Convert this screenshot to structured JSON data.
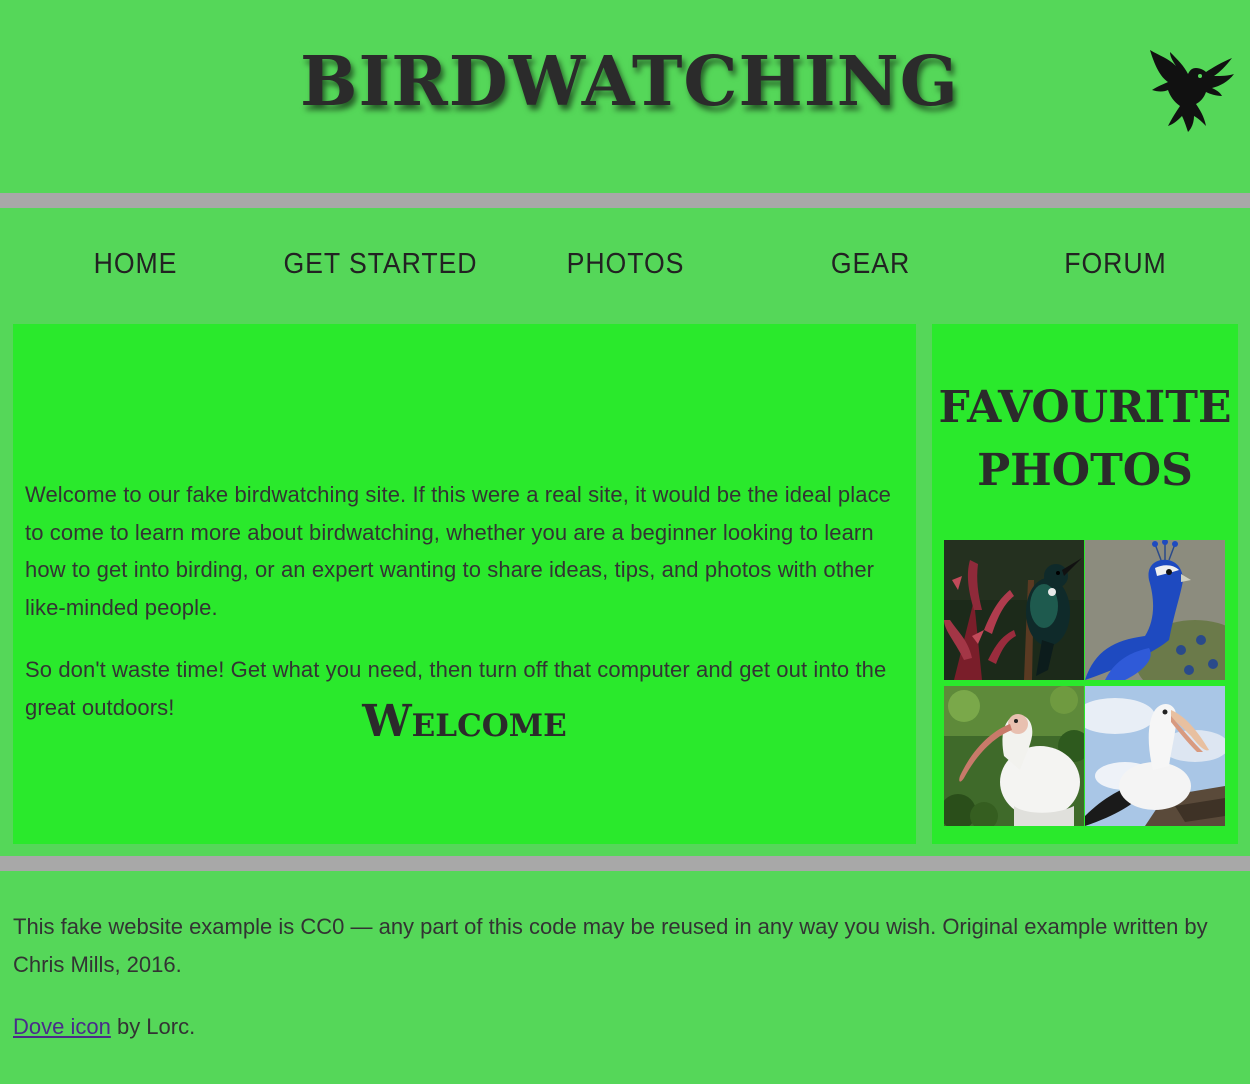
{
  "header": {
    "title": "Birdwatching",
    "logo_icon": "dove-icon"
  },
  "nav": {
    "items": [
      {
        "label": "Home"
      },
      {
        "label": "Get started"
      },
      {
        "label": "Photos"
      },
      {
        "label": "Gear"
      },
      {
        "label": "Forum"
      }
    ]
  },
  "main": {
    "title": "Welcome",
    "paragraphs": [
      "Welcome to our fake birdwatching site. If this were a real site, it would be the ideal place to come to learn more about birdwatching, whether you are a beginner looking to learn how to get into birding, or an expert wanting to share ideas, tips, and photos with other like-minded people.",
      "So don't waste time! Get what you need, then turn off that computer and get out into the great outdoors!"
    ]
  },
  "aside": {
    "title": "Favourite photos",
    "photos": [
      {
        "icon": "tui-bird-photo"
      },
      {
        "icon": "peacock-photo"
      },
      {
        "icon": "ibis-photo"
      },
      {
        "icon": "pelican-photo"
      }
    ]
  },
  "footer": {
    "license_text": "This fake website example is CC0 — any part of this code may be reused in any way you wish. Original example written by Chris Mills, 2016.",
    "credit_link": "Dove icon",
    "credit_suffix": " by Lorc."
  },
  "colors": {
    "page_background": "#55d759",
    "panel_background": "#2ae92c",
    "divider": "#a8a8a8",
    "link": "#4a2c8a"
  }
}
